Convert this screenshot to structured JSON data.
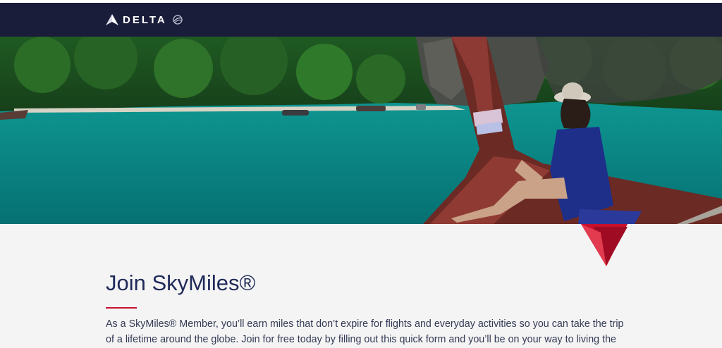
{
  "header": {
    "brand": "DELTA",
    "logo_icon": "delta-widget-icon",
    "globe_icon": "globe-icon",
    "bg_color": "#1a1d3a"
  },
  "hero": {
    "image": "turquoise-bay-longtail-boat-photo"
  },
  "main": {
    "title": "Join SkyMiles®",
    "intro": "As a SkyMiles® Member, you’ll earn miles that don’t expire for flights and everyday activities so you can take the trip of a lifetime around the globe. Join for free today by filling out this quick form and you’ll be on your way to living the"
  },
  "colors": {
    "brand_navy": "#1a1d3a",
    "title_navy": "#1f2a5a",
    "accent_red": "#c8102e"
  }
}
